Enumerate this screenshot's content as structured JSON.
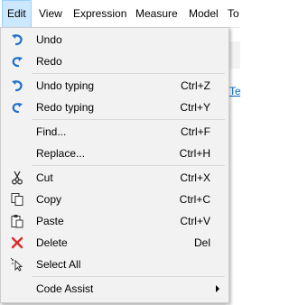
{
  "menubar": {
    "items": [
      {
        "label": "Edit"
      },
      {
        "label": "View"
      },
      {
        "label": "Expression"
      },
      {
        "label": "Measure"
      },
      {
        "label": "Model"
      },
      {
        "label": "To"
      }
    ]
  },
  "background": {
    "link_fragment": "Te"
  },
  "menu": {
    "items": [
      {
        "label": "Undo",
        "shortcut": "",
        "icon": "undo-icon"
      },
      {
        "label": "Redo",
        "shortcut": "",
        "icon": "redo-icon"
      },
      {
        "label": "Undo typing",
        "shortcut": "Ctrl+Z",
        "icon": "undo-icon"
      },
      {
        "label": "Redo typing",
        "shortcut": "Ctrl+Y",
        "icon": "redo-icon"
      },
      {
        "label": "Find...",
        "shortcut": "Ctrl+F",
        "icon": ""
      },
      {
        "label": "Replace...",
        "shortcut": "Ctrl+H",
        "icon": ""
      },
      {
        "label": "Cut",
        "shortcut": "Ctrl+X",
        "icon": "scissors-icon"
      },
      {
        "label": "Copy",
        "shortcut": "Ctrl+C",
        "icon": "copy-icon"
      },
      {
        "label": "Paste",
        "shortcut": "Ctrl+V",
        "icon": "paste-icon"
      },
      {
        "label": "Delete",
        "shortcut": "Del",
        "icon": "delete-icon"
      },
      {
        "label": "Select All",
        "shortcut": "",
        "icon": "select-all-icon"
      },
      {
        "label": "Code Assist",
        "shortcut": "",
        "icon": "",
        "submenu": true
      }
    ]
  },
  "colors": {
    "icon_blue": "#1e6fc9",
    "delete_red": "#d92b2b",
    "active_menubar_bg": "#cce8ff"
  }
}
